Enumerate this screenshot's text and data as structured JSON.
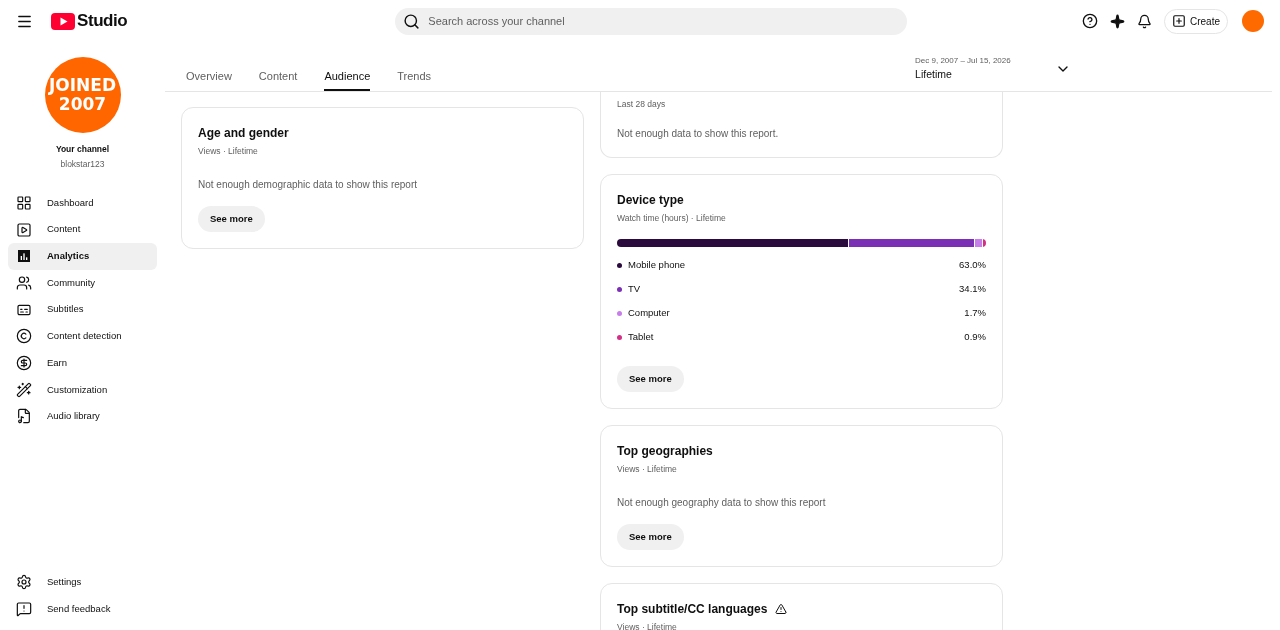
{
  "header": {
    "logo_text": "Studio",
    "search": {
      "placeholder": "Search across your channel"
    },
    "create_button": "Create"
  },
  "sidebar": {
    "avatar_text": [
      "JOINED",
      "2007"
    ],
    "channel_label": "Your channel",
    "channel_handle": "blokstar123",
    "items": [
      {
        "kind": "dashboard",
        "label": "Dashboard",
        "selected": false
      },
      {
        "kind": "content",
        "label": "Content",
        "selected": false
      },
      {
        "kind": "analytics",
        "label": "Analytics",
        "selected": true
      },
      {
        "kind": "community",
        "label": "Community",
        "selected": false
      },
      {
        "kind": "subtitles",
        "label": "Subtitles",
        "selected": false
      },
      {
        "kind": "detection",
        "label": "Content detection",
        "selected": false
      },
      {
        "kind": "earn",
        "label": "Earn",
        "selected": false
      },
      {
        "kind": "customization",
        "label": "Customization",
        "selected": false
      },
      {
        "kind": "audio",
        "label": "Audio library",
        "selected": false
      }
    ],
    "footer_items": [
      {
        "kind": "settings",
        "label": "Settings"
      },
      {
        "kind": "feedback",
        "label": "Send feedback"
      }
    ]
  },
  "tabs": [
    {
      "label": "Overview",
      "selected": false
    },
    {
      "label": "Content",
      "selected": false
    },
    {
      "label": "Audience",
      "selected": true
    },
    {
      "label": "Trends",
      "selected": false
    }
  ],
  "date_range": {
    "range": "Dec 9, 2007 – Jul 15, 2026",
    "label": "Lifetime"
  },
  "left_cards": [
    {
      "title": "Age and gender",
      "subtitle": "Views · Lifetime",
      "message": "Not enough demographic data to show this report",
      "button": "See more"
    }
  ],
  "formats_card": {
    "subtitle": "Last 28 days",
    "message": "Not enough data to show this report."
  },
  "device_card": {
    "title": "Device type",
    "subtitle": "Watch time (hours) · Lifetime",
    "button": "See more",
    "devices": [
      {
        "name": "Mobile phone",
        "reading": "63.0%",
        "color": "#2b0a3d"
      },
      {
        "name": "TV",
        "reading": "34.1%",
        "color": "#7b2fb5"
      },
      {
        "name": "Computer",
        "reading": "1.7%",
        "color": "#c77dea"
      },
      {
        "name": "Tablet",
        "reading": "0.9%",
        "color": "#d42f86"
      }
    ]
  },
  "geo_card": {
    "title": "Top geographies",
    "subtitle": "Views · Lifetime",
    "message": "Not enough geography data to show this report",
    "button": "See more"
  },
  "subtitle_card": {
    "title": "Top subtitle/CC languages",
    "warning": true,
    "subtitle": "Views · Lifetime"
  }
}
